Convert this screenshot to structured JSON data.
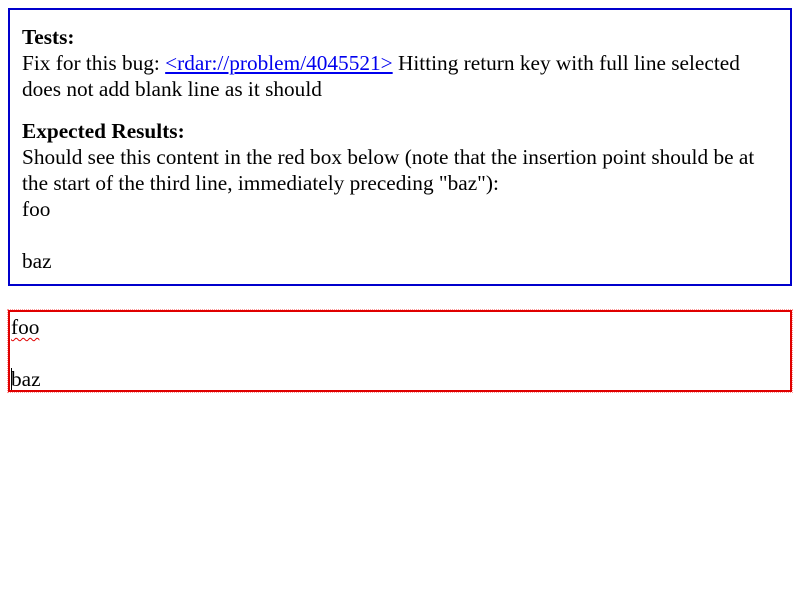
{
  "explanation": {
    "tests_heading": "Tests:",
    "fix_prefix": "Fix for this bug: ",
    "bug_link": "<rdar://problem/4045521>",
    "fix_suffix": " Hitting return key with full line selected does not add blank line as it should",
    "expected_heading": "Expected Results:",
    "expected_text": "Should see this content in the red box below (note that the insertion point should be at the start of the third line, immediately preceding \"baz\"):",
    "expected_lines": [
      "foo",
      "",
      "baz"
    ]
  },
  "editable_box": {
    "lines": [
      "foo",
      "",
      "baz"
    ],
    "border_color": "#e00000"
  },
  "colors": {
    "explanation_border": "#0000cc",
    "link": "#0000ee",
    "editable_border": "#e00000"
  }
}
